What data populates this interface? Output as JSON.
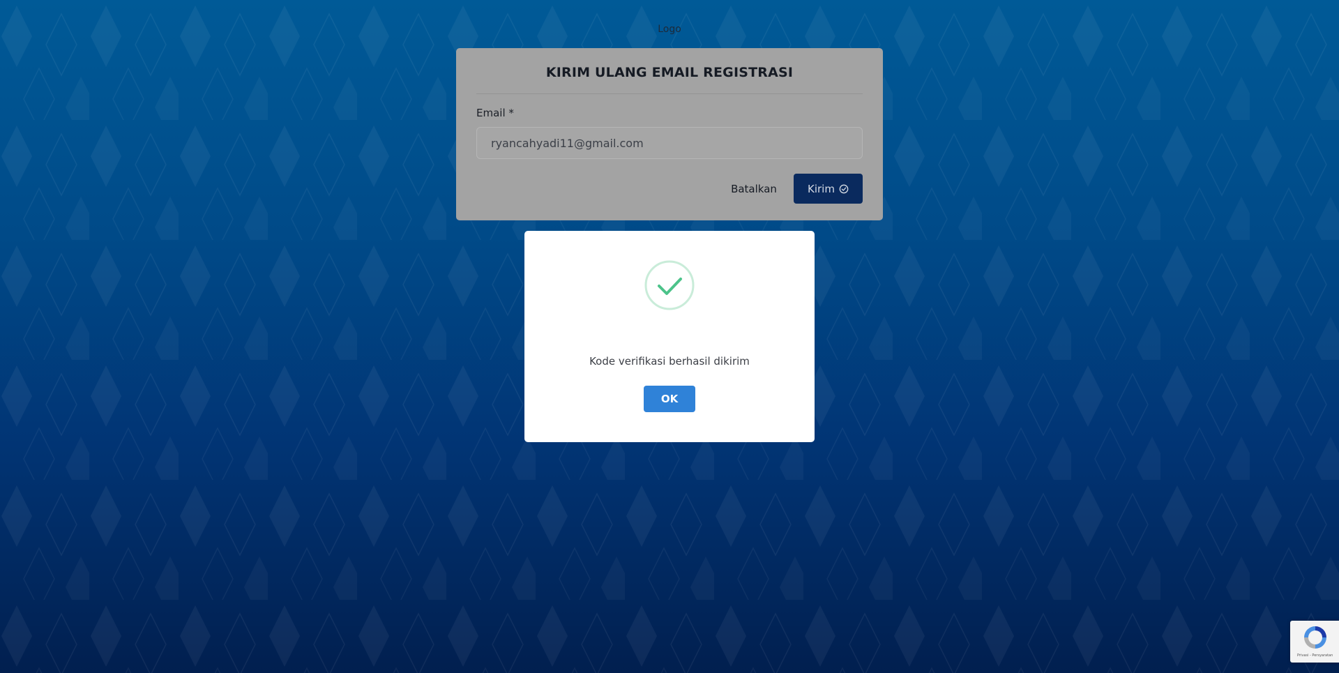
{
  "header": {
    "logo_text": "Logo"
  },
  "form": {
    "title": "KIRIM ULANG EMAIL REGISTRASI",
    "email_label": "Email *",
    "email_value": "ryancahyadi11@gmail.com",
    "cancel_label": "Batalkan",
    "send_label": "Kirim",
    "send_icon": "check-circle-icon"
  },
  "dialog": {
    "icon": "success-check-icon",
    "message": "Kode verifikasi berhasil dikirim",
    "ok_label": "OK"
  },
  "recaptcha": {
    "icon": "recaptcha-logo-icon",
    "footer_text": "Privasi - Persyaratan"
  },
  "colors": {
    "background_top": "#005a97",
    "background_bottom": "#011f4f",
    "primary_button": "#0a2a5e",
    "ok_button": "#2f82d8",
    "success_green": "#4cc38a"
  }
}
